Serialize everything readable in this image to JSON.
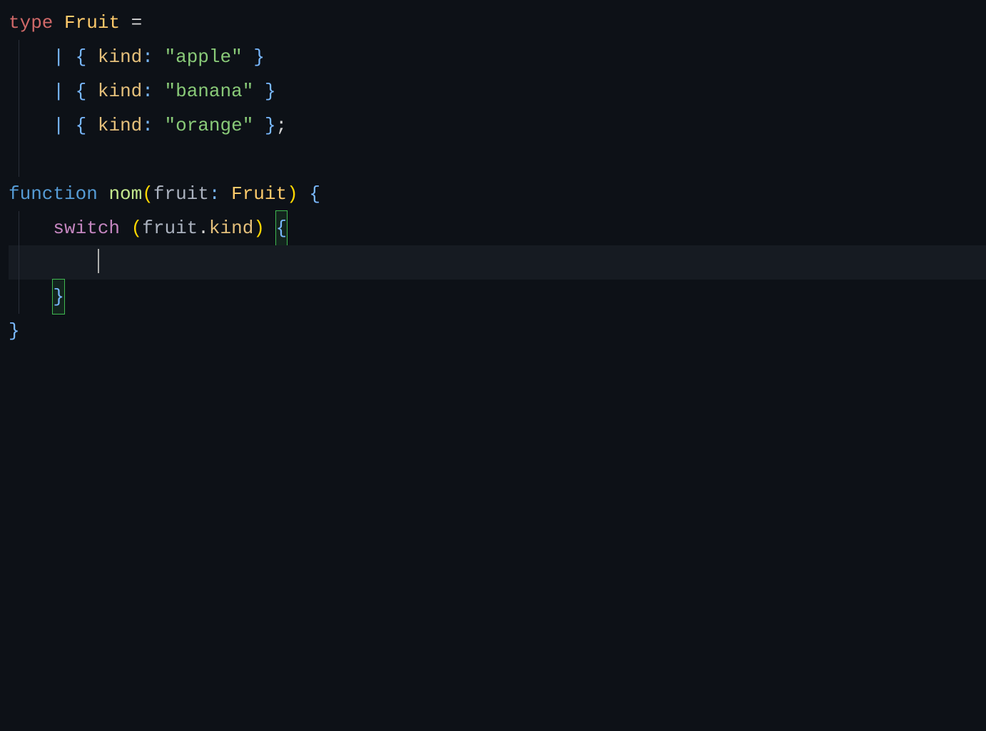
{
  "code": {
    "line1": {
      "kw_type": "type",
      "typename": "Fruit",
      "eq": "="
    },
    "line2": {
      "indent": "    ",
      "pipe": "|",
      "lbrace": "{",
      "prop": "kind",
      "colon": ":",
      "string": "\"apple\"",
      "rbrace": "}"
    },
    "line3": {
      "indent": "    ",
      "pipe": "|",
      "lbrace": "{",
      "prop": "kind",
      "colon": ":",
      "string": "\"banana\"",
      "rbrace": "}"
    },
    "line4": {
      "indent": "    ",
      "pipe": "|",
      "lbrace": "{",
      "prop": "kind",
      "colon": ":",
      "string": "\"orange\"",
      "rbrace": "}",
      "semi": ";"
    },
    "line6": {
      "kw_function": "function",
      "fn_name": "nom",
      "lparen": "(",
      "param": "fruit",
      "colon": ":",
      "typename": "Fruit",
      "rparen": ")",
      "lbrace": "{"
    },
    "line7": {
      "indent": "    ",
      "kw_switch": "switch",
      "lparen": "(",
      "obj": "fruit",
      "dot": ".",
      "prop": "kind",
      "rparen": ")",
      "lbrace": "{"
    },
    "line8": {
      "indent": "        "
    },
    "line9": {
      "indent": "    ",
      "rbrace": "}"
    },
    "line10": {
      "rbrace": "}"
    }
  }
}
